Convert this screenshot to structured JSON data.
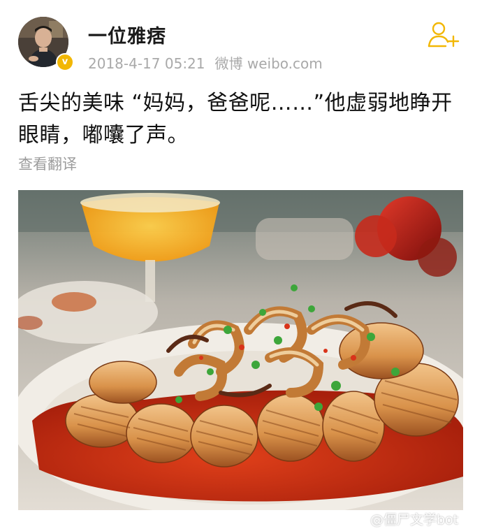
{
  "post": {
    "username": "一位雅痞",
    "timestamp": "2018-4-17 05:21",
    "source": "微博 weibo.com",
    "text_line1": "舌尖的美味 “妈妈，爸爸呢……”他虚弱地睁开",
    "text_line2": "眼睛，嘟囔了声。",
    "translate_label": "查看翻译",
    "verified_badge": "v"
  },
  "photo": {
    "subject": "fried squid with green onion and chili sauce"
  },
  "watermark": {
    "text": "@僵尸文学bot"
  },
  "colors": {
    "verified": "#f2b705",
    "follow_icon": "#f2b705",
    "meta_text": "#a9a9a9"
  },
  "icons": {
    "follow": "add-user-icon",
    "verified": "verified-badge-icon",
    "weibo": "weibo-logo-icon"
  }
}
